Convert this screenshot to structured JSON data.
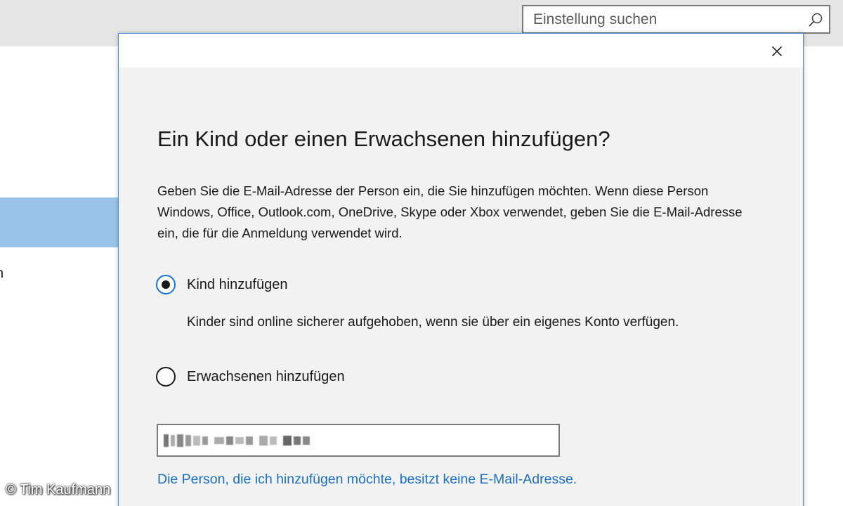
{
  "background": {
    "search": {
      "placeholder": "Einstellung suchen"
    },
    "sidebar_partial_text": "n"
  },
  "dialog": {
    "title": "Ein Kind oder einen Erwachsenen hinzufügen?",
    "description": "Geben Sie die E-Mail-Adresse der Person ein, die Sie hinzufügen möchten. Wenn diese Person Windows, Office, Outlook.com, OneDrive, Skype oder Xbox verwendet, geben Sie die E-Mail-Adresse ein, die für die Anmeldung verwendet wird.",
    "options": [
      {
        "label": "Kind hinzufügen",
        "selected": true,
        "help": "Kinder sind online sicherer aufgehoben, wenn sie über ein eigenes Konto verfügen."
      },
      {
        "label": "Erwachsenen hinzufügen",
        "selected": false
      }
    ],
    "email_value_obscured": true,
    "no_email_link": "Die Person, die ich hinzufügen möchte, besitzt keine E-Mail-Adresse."
  },
  "watermark": "© Tim Kaufmann",
  "colors": {
    "accent": "#1a73d9",
    "link": "#1a6fc2",
    "sidebar_selected": "#99c4e8",
    "dialog_border": "#4a90d9"
  },
  "icons": {
    "search": "search-icon",
    "close": "close-icon"
  }
}
